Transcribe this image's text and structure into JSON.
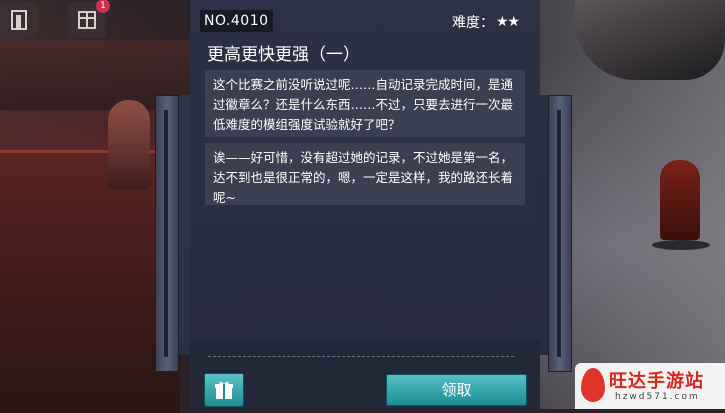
{
  "challenge": {
    "number": "NO.4010",
    "difficulty_label": "难度：",
    "difficulty_stars": "★★",
    "title": "更高更快更强（一）"
  },
  "dialog": {
    "first": "这个比赛之前没听说过呢……自动记录完成时间，是通过徽章么？还是什么东西……不过，只要去进行一次最低难度的模组强度试验就好了吧？",
    "second": "诶——好可惜，没有超过她的记录，不过她是第一名，达不到也是很正常的，嗯，一定是这样，我的路还长着呢~"
  },
  "actions": {
    "claim_label": "领取",
    "gift_icon": "gift-icon"
  },
  "hud": {
    "badge_count": "1",
    "icons": [
      "door-icon",
      "calendar-icon"
    ]
  },
  "watermark": {
    "brand": "旺达手游站",
    "domain": "hzwd571.com"
  },
  "colors": {
    "accent": "#1b8d93",
    "panel": "#2c3145",
    "watermark_red": "#d6271d"
  }
}
